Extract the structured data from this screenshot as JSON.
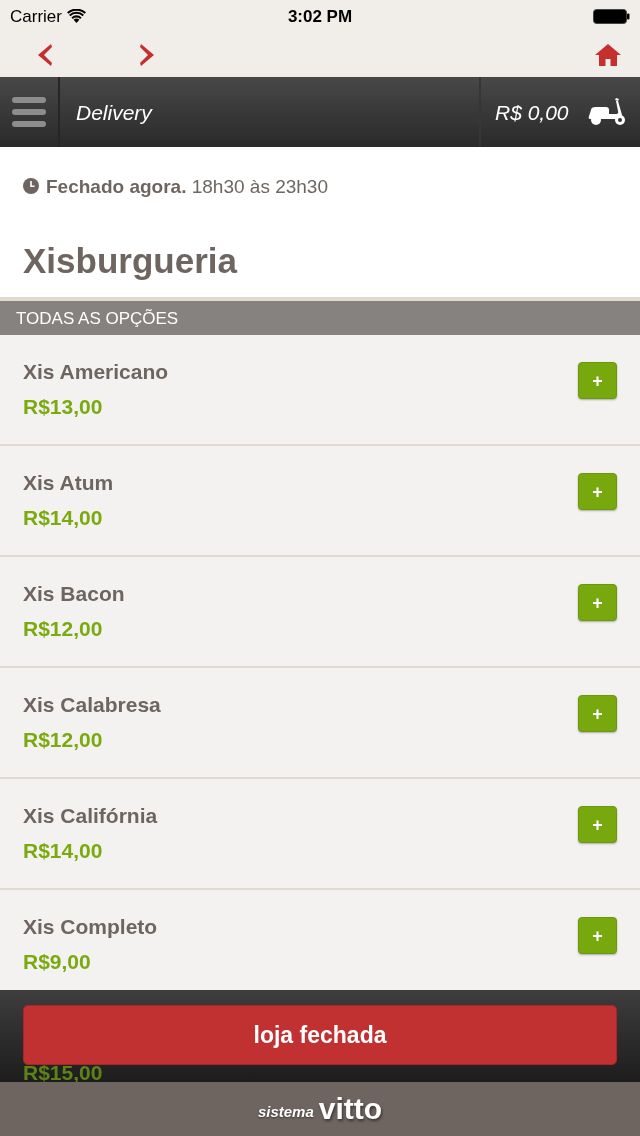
{
  "status_bar": {
    "carrier": "Carrier",
    "time": "3:02 PM"
  },
  "header": {
    "title": "Delivery",
    "cart_total": "R$ 0,00"
  },
  "store": {
    "hours_line": "**Fechado agora.** 18h30 às 23h30",
    "name": "Xisburgueria"
  },
  "section": {
    "title": "TODAS AS OPÇÕES"
  },
  "items": [
    {
      "name": "Xis Americano",
      "price": "R$13,00",
      "button": "+"
    },
    {
      "name": "Xis Atum",
      "price": "R$14,00",
      "button": "+"
    },
    {
      "name": "Xis Bacon",
      "price": "R$12,00",
      "button": "+"
    },
    {
      "name": "Xis Calabresa",
      "price": "R$12,00",
      "button": "+"
    },
    {
      "name": "Xis Califórnia",
      "price": "R$14,00",
      "button": "+"
    },
    {
      "name": "Xis Completo",
      "price": "R$9,00",
      "button": "+"
    },
    {
      "price": "R$15,00"
    }
  ],
  "order_button": {
    "label": "loja fechada"
  },
  "footer": {
    "brand_prefix": "sistema",
    "brand": "vitto"
  }
}
